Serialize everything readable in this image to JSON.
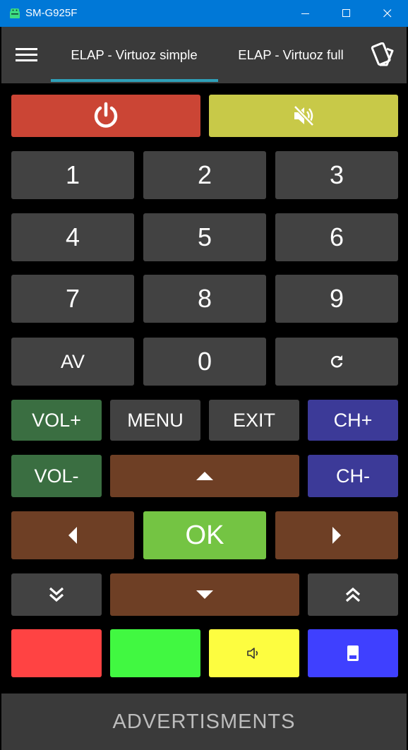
{
  "window": {
    "title": "SM-G925F",
    "icons": [
      "android-app-icon",
      "minimize-icon",
      "maximize-icon",
      "close-icon"
    ]
  },
  "appbar": {
    "tabs": [
      {
        "label": "ELAP - Virtuoz simple",
        "active": true
      },
      {
        "label": "ELAP - Virtuoz full",
        "active": false
      }
    ],
    "accent": "#2fa0b8"
  },
  "remote": {
    "power_icon": "power-icon",
    "mute_icon": "mute-icon",
    "digits": [
      "1",
      "2",
      "3",
      "4",
      "5",
      "6",
      "7",
      "8",
      "9"
    ],
    "av": "AV",
    "zero": "0",
    "refresh_icon": "refresh-icon",
    "vol_up": "VOL+",
    "menu": "MENU",
    "exit": "EXIT",
    "ch_up": "CH+",
    "vol_down": "VOL-",
    "ch_down": "CH-",
    "ok": "OK",
    "colors": {
      "power": "#cb4535",
      "mute": "#c8c948",
      "volume": "#3a6e41",
      "channel": "#3c3a98",
      "navigation": "#6e3f25",
      "ok": "#74c443",
      "key_red": "#ff4343",
      "key_green": "#41f841",
      "key_yellow": "#fdfd40",
      "key_blue": "#3f40ff"
    }
  },
  "ad": {
    "text": "ADVERTISMENTS"
  }
}
